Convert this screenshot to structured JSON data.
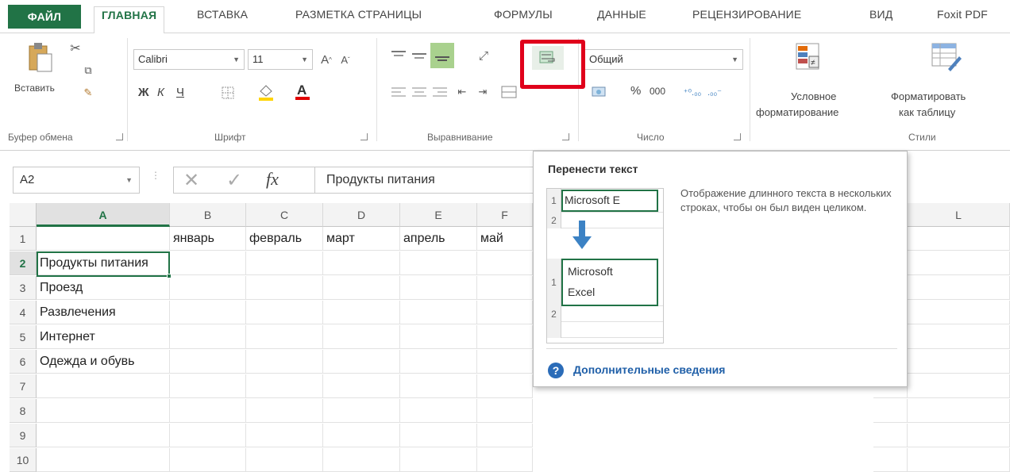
{
  "ribbon_tabs": {
    "file": "ФАЙЛ",
    "home": "ГЛАВНАЯ",
    "insert": "ВСТАВКА",
    "page_layout": "РАЗМЕТКА СТРАНИЦЫ",
    "formulas": "ФОРМУЛЫ",
    "data": "ДАННЫЕ",
    "review": "РЕЦЕНЗИРОВАНИЕ",
    "view": "ВИД",
    "foxit": "Foxit PDF"
  },
  "clipboard": {
    "paste_label": "Вставить",
    "group_label": "Буфер обмена"
  },
  "font": {
    "name": "Calibri",
    "size": "11",
    "bold": "Ж",
    "italic": "К",
    "underline": "Ч",
    "group_label": "Шрифт"
  },
  "alignment": {
    "group_label": "Выравнивание"
  },
  "number": {
    "format": "Общий",
    "percent": "%",
    "thousands": "000",
    "group_label": "Число"
  },
  "styles": {
    "conditional_line1": "Условное",
    "conditional_line2": "форматирование",
    "format_table_line1": "Форматировать",
    "format_table_line2": "как таблицу",
    "group_label": "Стили"
  },
  "formula_bar": {
    "name_box": "A2",
    "fx": "fx",
    "content": "Продукты питания"
  },
  "columns": [
    "A",
    "B",
    "C",
    "D",
    "E",
    "F",
    "L"
  ],
  "rows": [
    {
      "num": "1",
      "cells": [
        "",
        "январь",
        "февраль",
        "март",
        "апрель",
        "май"
      ]
    },
    {
      "num": "2",
      "cells": [
        "Продукты питания",
        "",
        "",
        "",
        "",
        ""
      ]
    },
    {
      "num": "3",
      "cells": [
        "Проезд",
        "",
        "",
        "",
        "",
        ""
      ]
    },
    {
      "num": "4",
      "cells": [
        "Развлечения",
        "",
        "",
        "",
        "",
        ""
      ]
    },
    {
      "num": "5",
      "cells": [
        "Интернет",
        "",
        "",
        "",
        "",
        ""
      ]
    },
    {
      "num": "6",
      "cells": [
        "Одежда и обувь",
        "",
        "",
        "",
        "",
        ""
      ]
    },
    {
      "num": "7",
      "cells": [
        "",
        "",
        "",
        "",
        "",
        ""
      ]
    },
    {
      "num": "8",
      "cells": [
        "",
        "",
        "",
        "",
        "",
        ""
      ]
    },
    {
      "num": "9",
      "cells": [
        "",
        "",
        "",
        "",
        "",
        ""
      ]
    },
    {
      "num": "10",
      "cells": [
        "",
        "",
        "",
        "",
        "",
        ""
      ]
    }
  ],
  "tooltip": {
    "title": "Перенести текст",
    "description": "Отображение длинного текста в нескольких строках, чтобы он был виден целиком.",
    "link": "Дополнительные сведения",
    "preview_before": "Microsoft E",
    "preview_after_line1": "Microsoft",
    "preview_after_line2": "Excel",
    "preview_row1": "1",
    "preview_row2": "2"
  },
  "colors": {
    "accent": "#217346",
    "highlight": "#e0001b",
    "link": "#1f5fa8"
  }
}
